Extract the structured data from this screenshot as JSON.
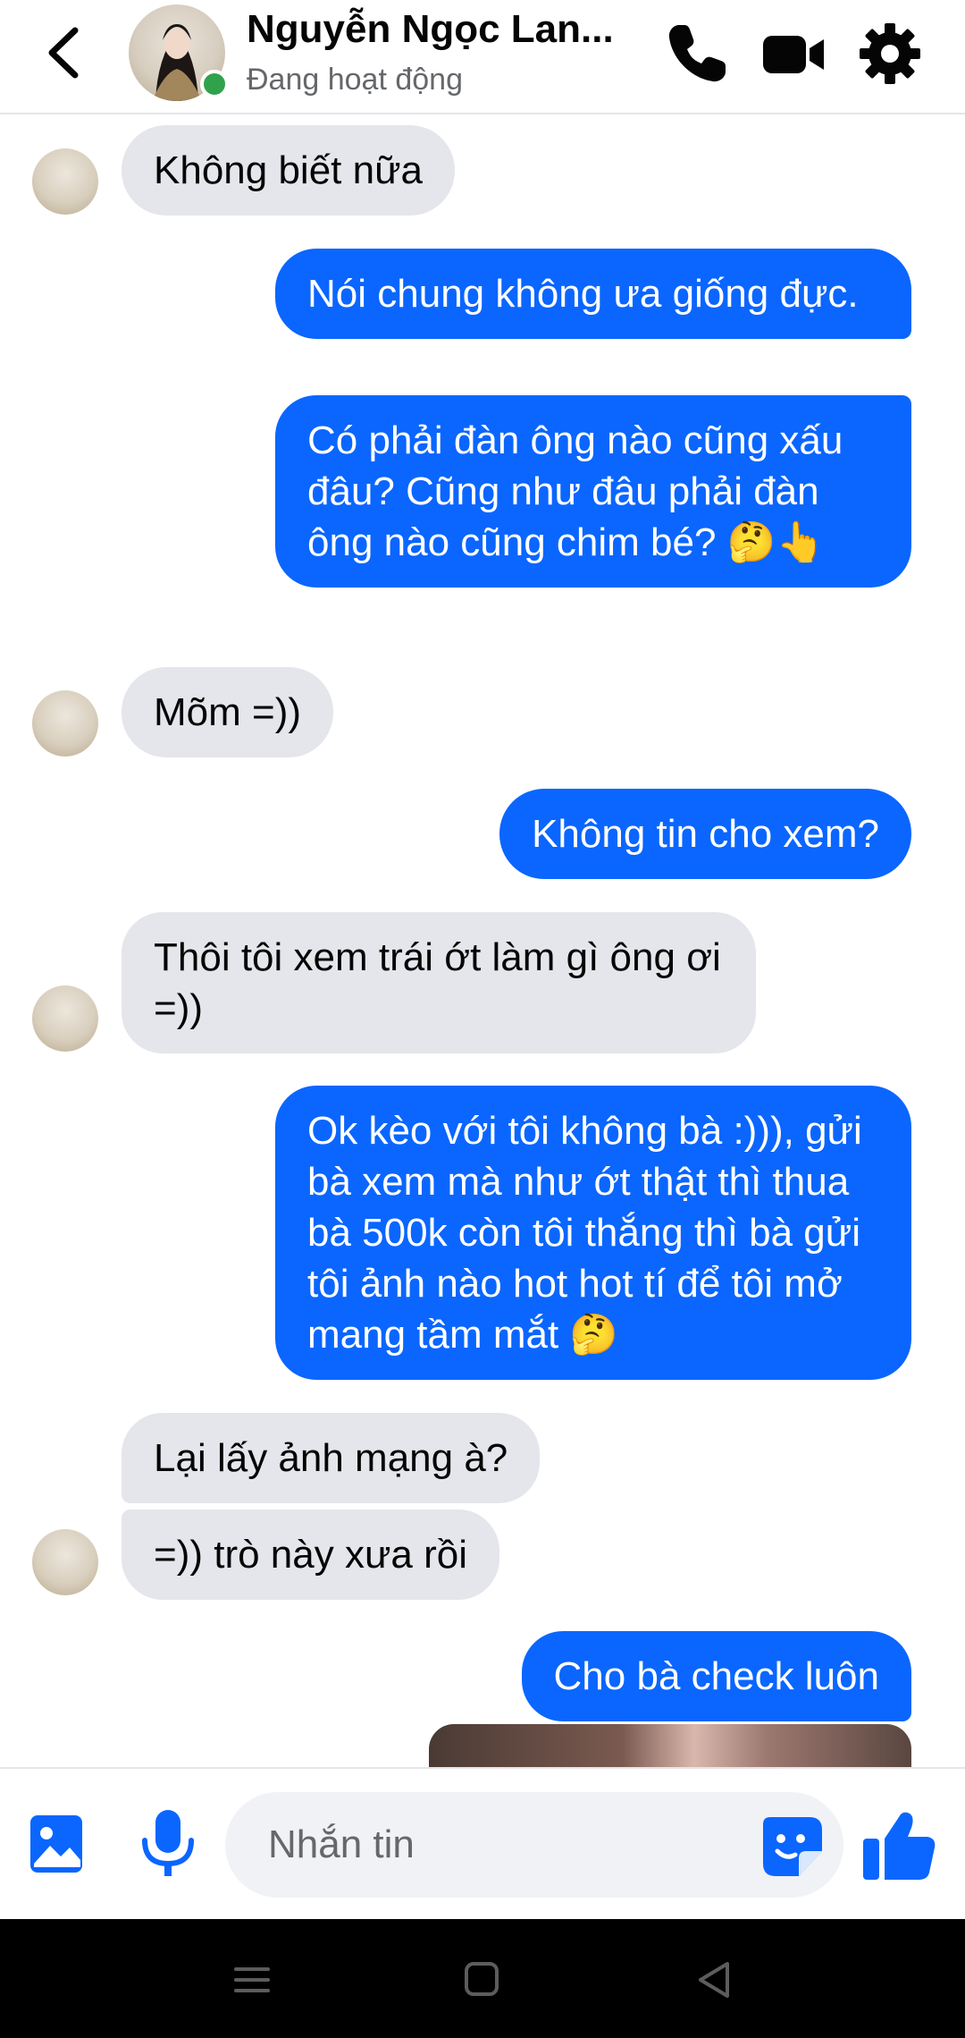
{
  "header": {
    "contact_name": "Nguyễn Ngọc Lan...",
    "status": "Đang hoạt động",
    "icons": {
      "back": "chevron-left-icon",
      "call": "phone-icon",
      "video": "video-camera-icon",
      "settings": "gear-icon"
    }
  },
  "messages": [
    {
      "side": "in",
      "text": "Không biết nữa"
    },
    {
      "side": "out",
      "text": "Nói chung không ưa giống đực."
    },
    {
      "side": "out",
      "text": "Có phải đàn ông nào cũng xấu đâu? Cũng như đâu phải đàn ông nào cũng chim bé? 🤔👆"
    },
    {
      "side": "in",
      "text": "Mõm =))"
    },
    {
      "side": "out",
      "text": "Không tin cho xem?"
    },
    {
      "side": "in",
      "text": "Thôi tôi xem trái ớt làm gì ông ơi =))"
    },
    {
      "side": "out",
      "text": "Ok kèo với tôi không bà :))), gửi bà xem mà như ớt thật thì thua bà 500k còn tôi thắng thì bà gửi tôi ảnh nào hot hot tí để tôi mở mang tầm mắt 🤔"
    },
    {
      "side": "in",
      "text": "Lại lấy ảnh mạng à?"
    },
    {
      "side": "in",
      "text": "=)) trò này xưa rồi"
    },
    {
      "side": "out",
      "text": "Cho bà check luôn"
    }
  ],
  "composer": {
    "placeholder": "Nhắn tin",
    "icons": {
      "image": "image-icon",
      "mic": "microphone-icon",
      "sticker": "sticker-icon",
      "like": "thumbs-up-icon"
    }
  },
  "navbar": {
    "icons": [
      "menu-icon",
      "home-icon",
      "back-triangle-icon"
    ]
  },
  "colors": {
    "accent": "#0a66ff",
    "incoming_bubble": "#e4e6eb",
    "online": "#31a24c"
  }
}
